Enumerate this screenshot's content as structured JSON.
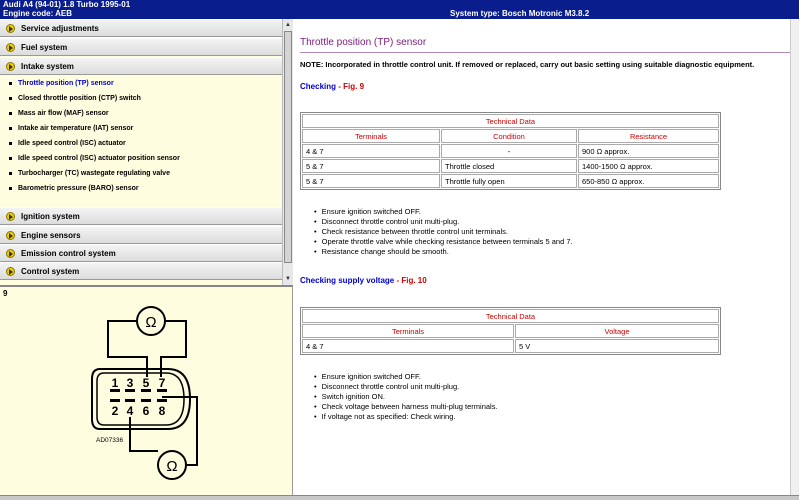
{
  "header": {
    "vehicle": "Audi   A4 (94-01) 1.8 Turbo 1995-01",
    "engine_code": "Engine code: AEB",
    "system_type": "System type: Bosch Motronic M3.8.2"
  },
  "sidebar": {
    "sections_top": [
      {
        "label": "Service adjustments"
      },
      {
        "label": "Fuel system"
      },
      {
        "label": "Intake system"
      }
    ],
    "subitems": [
      {
        "label": "Throttle position (TP) sensor"
      },
      {
        "label": "Closed throttle position (CTP) switch"
      },
      {
        "label": "Mass air flow (MAF) sensor"
      },
      {
        "label": "Intake air temperature (IAT) sensor"
      },
      {
        "label": "Idle speed control (ISC) actuator"
      },
      {
        "label": "Idle speed control (ISC) actuator position sensor"
      },
      {
        "label": "Turbocharger (TC) wastegate regulating valve"
      },
      {
        "label": "Barometric pressure (BARO) sensor"
      }
    ],
    "sections_bottom": [
      {
        "label": "Ignition system"
      },
      {
        "label": "Engine sensors"
      },
      {
        "label": "Emission control system"
      },
      {
        "label": "Control system"
      }
    ]
  },
  "figure": {
    "number": "9",
    "code": "AD07336",
    "ohm": "Ω",
    "pins_top": [
      "1",
      "3",
      "5",
      "7"
    ],
    "pins_bottom": [
      "2",
      "4",
      "6",
      "8"
    ]
  },
  "content": {
    "title": "Throttle position (TP) sensor",
    "note": "NOTE: Incorporated in throttle control unit. If removed or replaced, carry out basic setting using suitable diagnostic equipment.",
    "checking": {
      "label": "Checking",
      "sep": " - ",
      "fig": "Fig. 9"
    },
    "table1": {
      "caption": "Technical Data",
      "headers": [
        "Terminals",
        "Condition",
        "Resistance"
      ],
      "rows": [
        [
          "4 & 7",
          "-",
          "900 Ω approx."
        ],
        [
          "5 & 7",
          "Throttle closed",
          "1400-1500 Ω approx."
        ],
        [
          "5 & 7",
          "Throttle fully open",
          "650-850 Ω approx."
        ]
      ]
    },
    "bullets1": [
      "Ensure ignition switched OFF.",
      "Disconnect throttle control unit multi-plug.",
      "Check resistance between throttle control unit terminals.",
      "Operate throttle valve while checking resistance between terminals 5 and 7.",
      "Resistance change should be smooth."
    ],
    "supply": {
      "label": "Checking supply voltage",
      "sep": " - ",
      "fig": "Fig. 10"
    },
    "table2": {
      "caption": "Technical Data",
      "headers": [
        "Terminals",
        "Voltage"
      ],
      "rows": [
        [
          "4 & 7",
          "5 V"
        ]
      ]
    },
    "bullets2": [
      "Ensure ignition switched OFF.",
      "Disconnect throttle control unit multi-plug.",
      "Switch ignition ON.",
      "Check voltage between harness multi-plug terminals.",
      "If voltage not as specified: Check wiring."
    ]
  }
}
